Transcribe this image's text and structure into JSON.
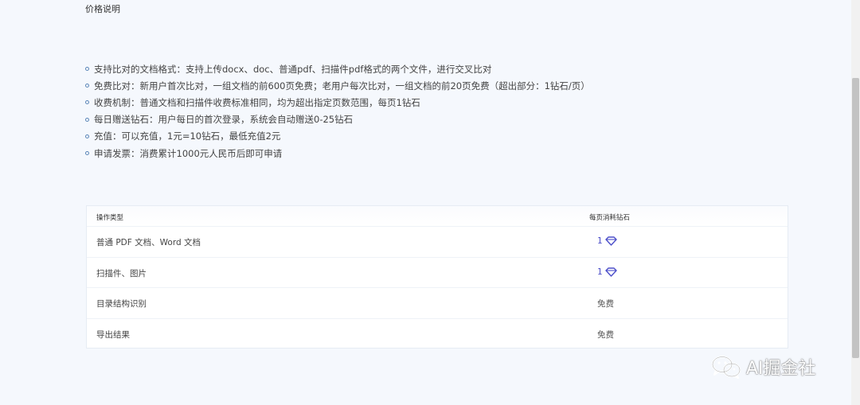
{
  "section": {
    "title": "价格说明"
  },
  "info_items": [
    "支持比对的文档格式：支持上传docx、doc、普通pdf、扫描件pdf格式的两个文件，进行交叉比对",
    "免费比对：新用户首次比对，一组文档的前600页免费；老用户每次比对，一组文档的前20页免费（超出部分：1钻石/页）",
    "收费机制：普通文档和扫描件收费标准相同，均为超出指定页数范围，每页1钻石",
    "每日赠送钻石：用户每日的首次登录，系统会自动赠送0-25钻石",
    "充值：可以充值，1元=10钻石，最低充值2元",
    "申请发票：消费累计1000元人民币后即可申请"
  ],
  "table": {
    "headers": {
      "type": "操作类型",
      "cost": "每页消耗钻石"
    },
    "rows": [
      {
        "type": "普通 PDF 文档、Word 文档",
        "cost": "1",
        "icon": "diamond-icon"
      },
      {
        "type": "扫描件、图片",
        "cost": "1",
        "icon": "diamond-icon"
      },
      {
        "type": "目录结构识别",
        "cost": "免费"
      },
      {
        "type": "导出结果",
        "cost": "免费"
      }
    ]
  },
  "watermark": {
    "text": "AI掘金社",
    "icon": "wechat-icon"
  },
  "colors": {
    "accent": "#4c4ec9",
    "background": "#f5f8fd",
    "bullet": "#5b86b8"
  }
}
